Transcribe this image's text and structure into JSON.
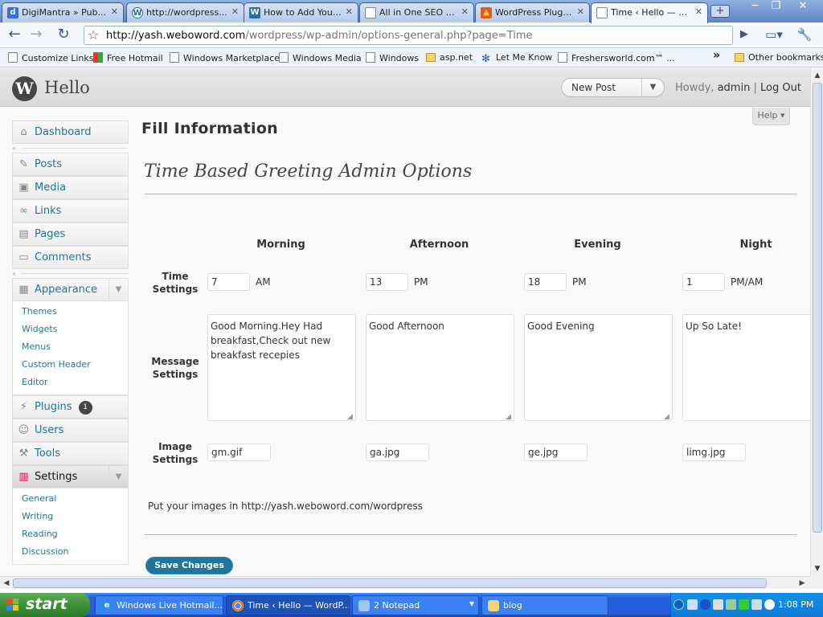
{
  "browser": {
    "tabs": [
      {
        "label": "DigiMantra » Pub...",
        "icon": "digimantra-favicon",
        "icon_text": "d"
      },
      {
        "label": "http://wordpress...",
        "icon": "wordpress-favicon",
        "icon_text": "W"
      },
      {
        "label": "How to Add Your...",
        "icon": "wordpress-favicon",
        "icon_text": "W"
      },
      {
        "label": "All in One SEO P...",
        "icon": "page-icon",
        "icon_text": ""
      },
      {
        "label": "WordPress Plugin...",
        "icon": "plugin-favicon",
        "icon_text": "▲"
      },
      {
        "label": "Time ‹ Hello — W...",
        "icon": "page-icon",
        "icon_text": ""
      }
    ],
    "new_tab_label": "+",
    "url_host": "http://yash.weboword.com",
    "url_path": "/wordpress/wp-admin/options-general.php?page=Time",
    "bookmarks": [
      {
        "label": "Customize Links",
        "icon": "page-icon"
      },
      {
        "label": "Free Hotmail",
        "icon": "windows-flag-icon"
      },
      {
        "label": "Windows Marketplace",
        "icon": "page-icon"
      },
      {
        "label": "Windows Media",
        "icon": "page-icon"
      },
      {
        "label": "Windows",
        "icon": "page-icon"
      },
      {
        "label": "asp.net",
        "icon": "folder-icon"
      },
      {
        "label": "Let Me Know",
        "icon": "snowflake-icon"
      },
      {
        "label": "Freshersworld.com™ ...",
        "icon": "page-icon"
      }
    ],
    "bookmarks_overflow": "»",
    "other_bookmarks": "Other bookmarks"
  },
  "wp": {
    "site_name": "Hello",
    "new_post": "New Post",
    "howdy": "Howdy,",
    "user": "admin",
    "separator": "|",
    "logout": "Log Out",
    "help": "Help ▾",
    "menu": {
      "dashboard": "Dashboard",
      "posts": "Posts",
      "media": "Media",
      "links": "Links",
      "pages": "Pages",
      "comments": "Comments",
      "appearance": "Appearance",
      "appearance_sub": [
        "Themes",
        "Widgets",
        "Menus",
        "Custom Header",
        "Editor"
      ],
      "plugins": "Plugins",
      "plugins_count": "1",
      "users": "Users",
      "tools": "Tools",
      "settings": "Settings",
      "settings_sub": [
        "General",
        "Writing",
        "Reading",
        "Discussion"
      ]
    },
    "page_title": "Fill Information",
    "options_title": "Time Based Greeting Admin Options",
    "columns": [
      "Morning",
      "Afternoon",
      "Evening",
      "Night"
    ],
    "row_labels": {
      "time": [
        "Time",
        "Settings"
      ],
      "message": [
        "Message",
        "Settings"
      ],
      "image": [
        "Image",
        "Settings"
      ]
    },
    "time_values": [
      "7",
      "13",
      "18",
      "1"
    ],
    "time_units": [
      "AM",
      "PM",
      "PM",
      "PM/AM"
    ],
    "messages": [
      "Good Morning.Hey Had breakfast,Check out new breakfast recepies",
      "Good Afternoon",
      "Good Evening",
      "Up So Late!"
    ],
    "images": [
      "gm.gif",
      "ga.jpg",
      "ge.jpg",
      "limg.jpg"
    ],
    "note": "Put your images in http://yash.weboword.com/wordpress",
    "save_label": "Save Changes"
  },
  "taskbar": {
    "start": "start",
    "tasks": [
      {
        "label": "Windows Live Hotmail...",
        "icon": "ie-icon"
      },
      {
        "label": "Time ‹ Hello — WordP...",
        "icon": "chrome-icon"
      },
      {
        "label": "2 Notepad",
        "icon": "notepad-icon"
      },
      {
        "label": "blog",
        "icon": "folder-icon"
      }
    ],
    "clock": "1:08 PM"
  }
}
